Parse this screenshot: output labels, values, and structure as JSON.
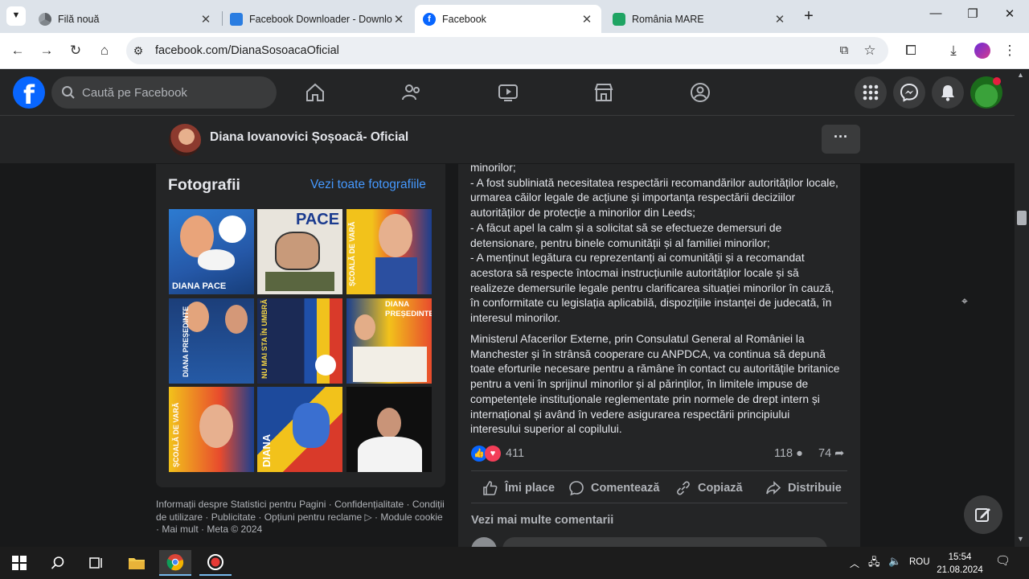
{
  "browser": {
    "tabs": [
      {
        "title": "Filă nouă"
      },
      {
        "title": "Facebook Downloader - Downlo"
      },
      {
        "title": "Facebook"
      },
      {
        "title": "România MARE"
      }
    ],
    "url": "facebook.com/DianaSosoacaOficial"
  },
  "facebook": {
    "search_placeholder": "Caută pe Facebook"
  },
  "page": {
    "name": "Diana Iovanovici Șoșoacă- Oficial",
    "more": "···"
  },
  "photos": {
    "title": "Fotografii",
    "see_all": "Vezi toate fotografiile",
    "items": [
      {
        "caption": "DIANA PACE"
      },
      {
        "caption": "PACE"
      },
      {
        "caption": "ȘCOALĂ DE VARĂ"
      },
      {
        "caption": "DIANA PREȘEDINTE"
      },
      {
        "caption": "NU MAI STA ÎN UMBRĂ"
      },
      {
        "caption": "DIANA PREȘEDINTE"
      },
      {
        "caption": "ȘCOALĂ DE VARĂ"
      },
      {
        "caption": "DIANA"
      },
      {
        "caption": ""
      }
    ]
  },
  "footer": {
    "text": "Informații despre Statistici pentru Pagini · Confidențialitate · Condiții de utilizare · Publicitate · Opțiuni pentru reclame ▷ · Module cookie · Mai mult · Meta © 2024"
  },
  "post": {
    "paragraph1_lines": [
      "minorilor;",
      "- A fost subliniată necesitatea respectării recomandărilor autorităților locale,",
      "urmarea căilor legale de acțiune și importanța respectării deciziilor",
      "autorităților de protecție a minorilor din Leeds;",
      "- A făcut apel la calm și a solicitat să se efectueze demersuri de",
      "detensionare, pentru binele comunității și al familiei minorilor;",
      "- A menținut legătura cu reprezentanți ai comunității și a recomandat",
      "acestora să respecte întocmai instrucțiunile autorităților locale și să",
      "realizeze demersurile legale pentru clarificarea situației minorilor în cauză,",
      "în conformitate cu legislația aplicabilă, dispozițiile instanței de judecată, în",
      "interesul minorilor."
    ],
    "paragraph2_lines": [
      "Ministerul Afacerilor Externe, prin Consulatul General al României la",
      "Manchester și în strânsă cooperare cu ANPDCA, va continua să depună",
      "toate eforturile necesare pentru a rămâne în contact cu autoritățile britanice",
      "pentru a veni în sprijinul minorilor și al părinților, în limitele impuse de",
      "competențele instituționale reglementate prin normele de drept intern și",
      "internațional și având în vedere asigurarea respectării principiului",
      "interesului superior al copilului."
    ],
    "reactions_count": "411",
    "comments_count": "118",
    "shares_count": "74",
    "actions": {
      "like": "Îmi place",
      "comment": "Comentează",
      "copy": "Copiază",
      "share": "Distribuie"
    },
    "more_comments": "Vezi mai multe comentarii"
  },
  "taskbar": {
    "lang": "ROU",
    "time": "15:54",
    "date": "21.08.2024"
  },
  "colors": {
    "fb_blue": "#0866ff",
    "link": "#4599ff",
    "bg": "#18191a",
    "card": "#242526"
  }
}
